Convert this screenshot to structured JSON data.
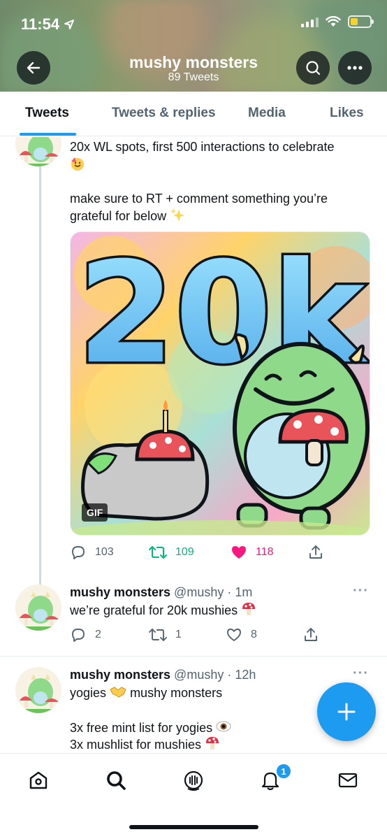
{
  "status_bar": {
    "time": "11:54"
  },
  "header": {
    "title": "mushy monsters",
    "subtitle": "89 Tweets"
  },
  "tabs": [
    {
      "label": "Tweets",
      "active": true
    },
    {
      "label": "Tweets & replies",
      "active": false
    },
    {
      "label": "Media",
      "active": false
    },
    {
      "label": "Likes",
      "active": false
    }
  ],
  "tweets": [
    {
      "line1": "20x WL spots, first 500 interactions to celebrate",
      "line2": "make sure to RT + comment something you’re",
      "line3": "grateful for below",
      "media": {
        "big_text": "20k",
        "badge": "GIF"
      },
      "replies": "103",
      "retweets": "109",
      "likes": "118",
      "liked": true
    },
    {
      "name": "mushy monsters",
      "handle": "@mushy · 1m",
      "text": "we’re grateful for 20k mushies",
      "replies": "2",
      "retweets": "1",
      "likes": "8"
    },
    {
      "name": "mushy monsters",
      "handle": "@mushy · 12h",
      "line1": "yogies",
      "line1b": "mushy monsters",
      "line2": "3x free mint list for yogies",
      "line3": "3x mushlist for mushies"
    }
  ],
  "bottom_nav": {
    "notifications_badge": "1"
  },
  "colors": {
    "accent": "#1d9bf0",
    "like": "#f91880",
    "retweet": "#00ba7c"
  }
}
